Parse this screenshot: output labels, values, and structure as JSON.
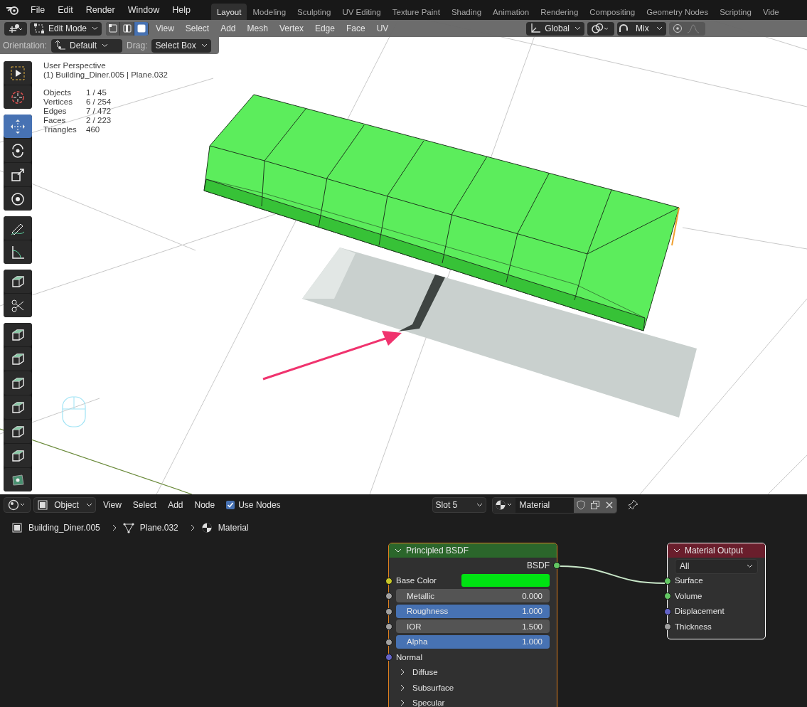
{
  "menu_bar": {
    "menus": [
      "File",
      "Edit",
      "Render",
      "Window",
      "Help"
    ],
    "workspace_tabs": [
      {
        "label": "Layout",
        "selected": true
      },
      {
        "label": "Modeling",
        "selected": false
      },
      {
        "label": "Sculpting",
        "selected": false
      },
      {
        "label": "UV Editing",
        "selected": false
      },
      {
        "label": "Texture Paint",
        "selected": false
      },
      {
        "label": "Shading",
        "selected": false
      },
      {
        "label": "Animation",
        "selected": false
      },
      {
        "label": "Rendering",
        "selected": false
      },
      {
        "label": "Compositing",
        "selected": false
      },
      {
        "label": "Geometry Nodes",
        "selected": false
      },
      {
        "label": "Scripting",
        "selected": false
      },
      {
        "label": "Vide",
        "selected": false
      }
    ]
  },
  "viewport_header": {
    "mode": "Edit Mode",
    "select_modes": [
      {
        "selected": false
      },
      {
        "selected": false
      },
      {
        "selected": true
      }
    ],
    "menus": [
      "View",
      "Select",
      "Add",
      "Mesh",
      "Vertex",
      "Edge",
      "Face",
      "UV"
    ],
    "orientation": "Global",
    "proportional_falloff": "Mix",
    "proportional_editing": false
  },
  "tool_settings": {
    "orientation_label": "Orientation:",
    "orientation": "Default",
    "drag_label": "Drag:",
    "drag": "Select Box"
  },
  "overlay": {
    "view_name": "User Perspective",
    "object_path": "(1) Building_Diner.005 | Plane.032",
    "stats": [
      {
        "label": "Objects",
        "value": "1 / 45"
      },
      {
        "label": "Vertices",
        "value": "6 / 254"
      },
      {
        "label": "Edges",
        "value": "7 / 472"
      },
      {
        "label": "Faces",
        "value": "2 / 223"
      },
      {
        "label": "Triangles",
        "value": "460"
      }
    ]
  },
  "toolbar": {
    "groups": [
      {
        "tools": [
          {
            "selected": false
          },
          {
            "selected": false
          }
        ]
      },
      {
        "tools": [
          {
            "selected": true
          },
          {
            "selected": false
          },
          {
            "selected": false
          },
          {
            "selected": false
          }
        ]
      },
      {
        "tools": [
          {
            "selected": false
          },
          {
            "selected": false
          }
        ]
      },
      {
        "tools": [
          {
            "selected": false
          },
          {
            "selected": false
          }
        ]
      },
      {
        "tools": [
          {
            "selected": false
          },
          {
            "selected": false
          },
          {
            "selected": false
          },
          {
            "selected": false
          },
          {
            "selected": false
          },
          {
            "selected": false
          },
          {
            "selected": false
          }
        ]
      }
    ]
  },
  "node_header": {
    "mode": "Object",
    "menus": [
      "View",
      "Select",
      "Add",
      "Node"
    ],
    "use_nodes": {
      "label": "Use Nodes",
      "checked": true
    },
    "slot": "Slot 5",
    "material": "Material"
  },
  "breadcrumbs": [
    "Building_Diner.005",
    "Plane.032",
    "Material"
  ],
  "nodes": [
    {
      "kind": "principled",
      "title": "Principled BSDF",
      "color": "#2b662b",
      "selected": true,
      "active": false,
      "outputs": [
        {
          "label": "BSDF",
          "color": "#63c763"
        }
      ],
      "inputs": [
        {
          "kind": "color",
          "label": "Base Color",
          "color": "#c7c729",
          "swatch": {
            "color": "#00e312"
          }
        },
        {
          "kind": "number",
          "label": "Metallic",
          "value": "0.000",
          "color": "#a1a1a1"
        },
        {
          "kind": "slider",
          "label": "Roughness",
          "value": "1.000",
          "level": 1,
          "color": "#a1a1a1"
        },
        {
          "kind": "number",
          "label": "IOR",
          "value": "1.500",
          "color": "#a1a1a1"
        },
        {
          "kind": "slider",
          "label": "Alpha",
          "value": "1.000",
          "level": 1,
          "color": "#a1a1a1"
        },
        {
          "kind": "socket",
          "label": "Normal",
          "color": "#6363c7"
        },
        {
          "kind": "panel",
          "label": "Diffuse",
          "expanded": false
        },
        {
          "kind": "panel",
          "label": "Subsurface",
          "expanded": false
        },
        {
          "kind": "panel",
          "label": "Specular",
          "expanded": false
        }
      ]
    },
    {
      "kind": "output",
      "title": "Material Output",
      "color": "#6a1e2c",
      "selected": true,
      "active": true,
      "target": "All",
      "inputs": [
        {
          "kind": "socket",
          "label": "Surface",
          "color": "#63c763"
        },
        {
          "kind": "socket",
          "label": "Volume",
          "color": "#63c763"
        },
        {
          "kind": "socket",
          "label": "Displacement",
          "color": "#6363c7"
        },
        {
          "kind": "socket",
          "label": "Thickness",
          "color": "#a1a1a1"
        }
      ]
    }
  ]
}
